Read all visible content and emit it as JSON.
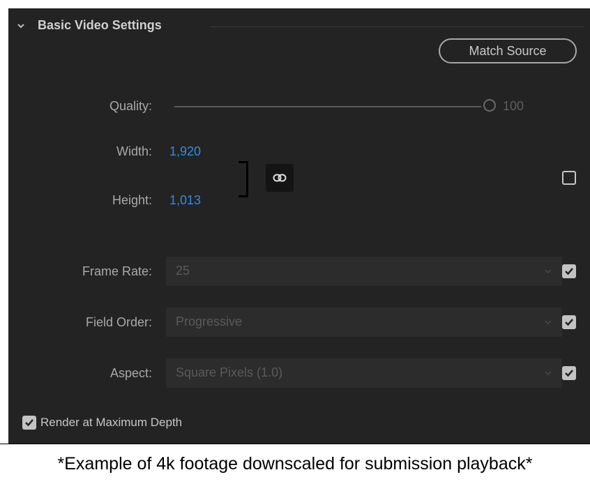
{
  "section": {
    "title": "Basic Video Settings",
    "match_source_label": "Match Source"
  },
  "quality": {
    "label": "Quality:",
    "value": "100",
    "level": 1.0
  },
  "dimensions": {
    "width_label": "Width:",
    "width_value": "1,920",
    "height_label": "Height:",
    "height_value": "1,013",
    "link_icon": "link-icon",
    "checkbox_checked": false
  },
  "frame_rate": {
    "label": "Frame Rate:",
    "value": "25",
    "checked": true
  },
  "field_order": {
    "label": "Field Order:",
    "value": "Progressive",
    "checked": true
  },
  "aspect": {
    "label": "Aspect:",
    "value": "Square Pixels (1.0)",
    "checked": true
  },
  "render_max_depth": {
    "label": "Render at Maximum Depth",
    "checked": true
  },
  "caption": "*Example of 4k footage downscaled for submission playback*",
  "colors": {
    "panel_bg": "#232323",
    "accent_blue": "#2d8ceb",
    "label_gray": "#a9a9a9"
  }
}
